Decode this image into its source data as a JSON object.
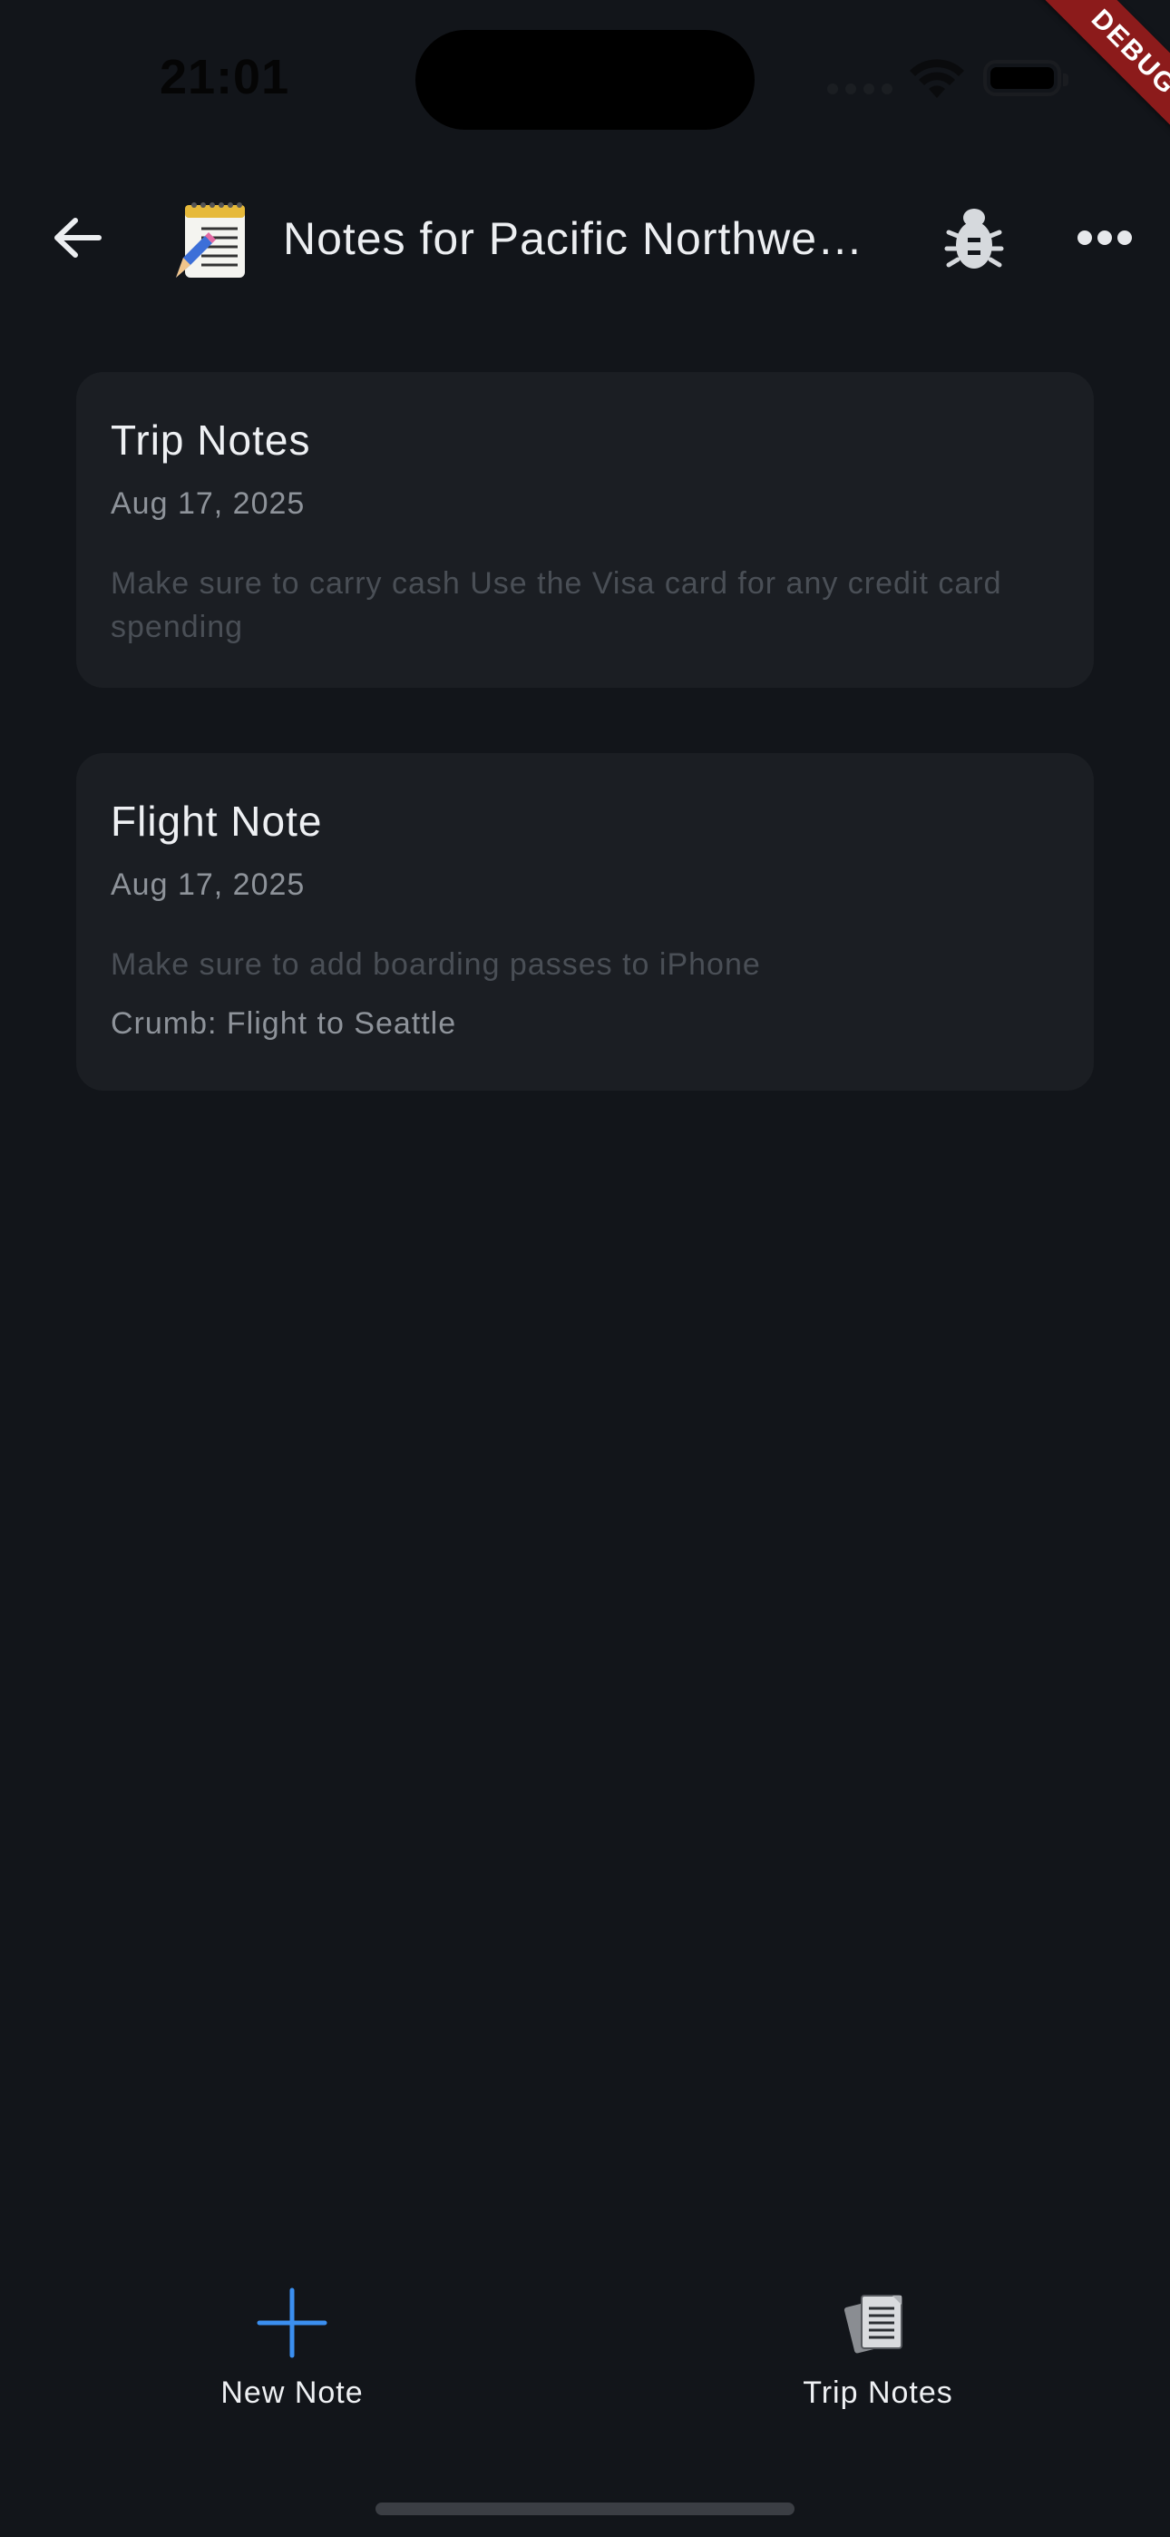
{
  "status_bar": {
    "time": "21:01"
  },
  "debug_banner": {
    "label": "DEBUG"
  },
  "app_bar": {
    "title": "Notes for Pacific Northwest Trip",
    "back_icon": "arrow-left-icon",
    "leading_icon": "memo-emoji-icon",
    "actions": [
      "bug-icon",
      "more-horizontal-icon"
    ]
  },
  "notes": [
    {
      "title": "Trip Notes",
      "date": "Aug 17, 2025",
      "body": "Make sure to carry cash Use the Visa card for any credit card spending",
      "crumb": ""
    },
    {
      "title": "Flight Note",
      "date": "Aug 17, 2025",
      "body": "Make sure to add boarding passes to iPhone",
      "crumb": "Crumb: Flight to Seattle"
    }
  ],
  "bottom_nav": {
    "new_note": {
      "label": "New Note",
      "icon": "plus-icon"
    },
    "trip_notes": {
      "label": "Trip Notes",
      "icon": "documents-icon"
    }
  },
  "colors": {
    "background": "#12151a",
    "card": "#1b1e23",
    "accent": "#3b8ff0",
    "debug": "#8c1b1b"
  }
}
